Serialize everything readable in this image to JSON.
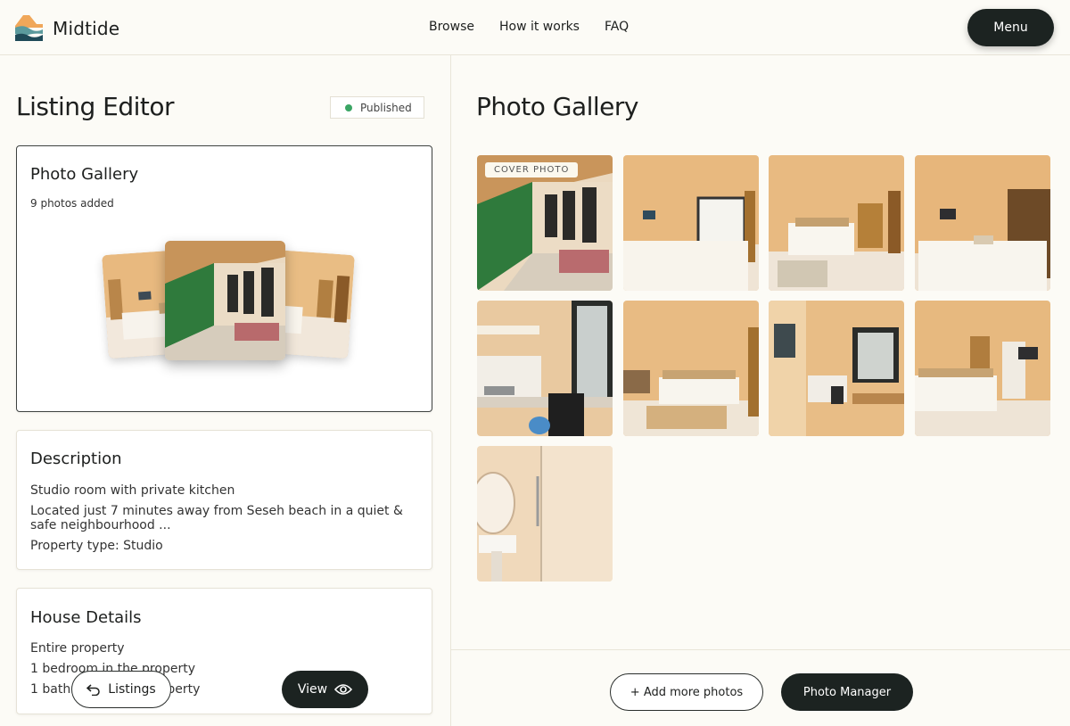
{
  "brand": {
    "name": "Midtide"
  },
  "nav": {
    "browse": "Browse",
    "how": "How it works",
    "faq": "FAQ",
    "menu": "Menu"
  },
  "editor": {
    "title": "Listing Editor",
    "status": "Published",
    "gallery_card": {
      "title": "Photo Gallery",
      "count": "9 photos added"
    },
    "description": {
      "title": "Description",
      "line1": "Studio room with private kitchen",
      "line2": "Located just 7 minutes away from Seseh beach in a quiet &",
      "line3": "safe neighbourhood ...",
      "line4": "Property type: Studio"
    },
    "house": {
      "title": "House Details",
      "line1": "Entire property",
      "line2": "1 bedroom in the property",
      "line3": "1 bathroom in the property"
    },
    "listings_button": "Listings",
    "view_button": "View"
  },
  "gallery": {
    "title": "Photo Gallery",
    "cover_label": "COVER PHOTO",
    "photos": [
      "patio-icon",
      "bedroom-icon",
      "bedroom-icon",
      "bedroom-icon",
      "kitchen-icon",
      "bedroom-icon",
      "kitchenette-icon",
      "bedroom-icon",
      "bathroom-icon"
    ],
    "add_button": "+ Add more photos",
    "manager_button": "Photo Manager"
  },
  "colors": {
    "accent": "#1c2321",
    "published": "#3aa564",
    "wall": "#e8b97f"
  }
}
